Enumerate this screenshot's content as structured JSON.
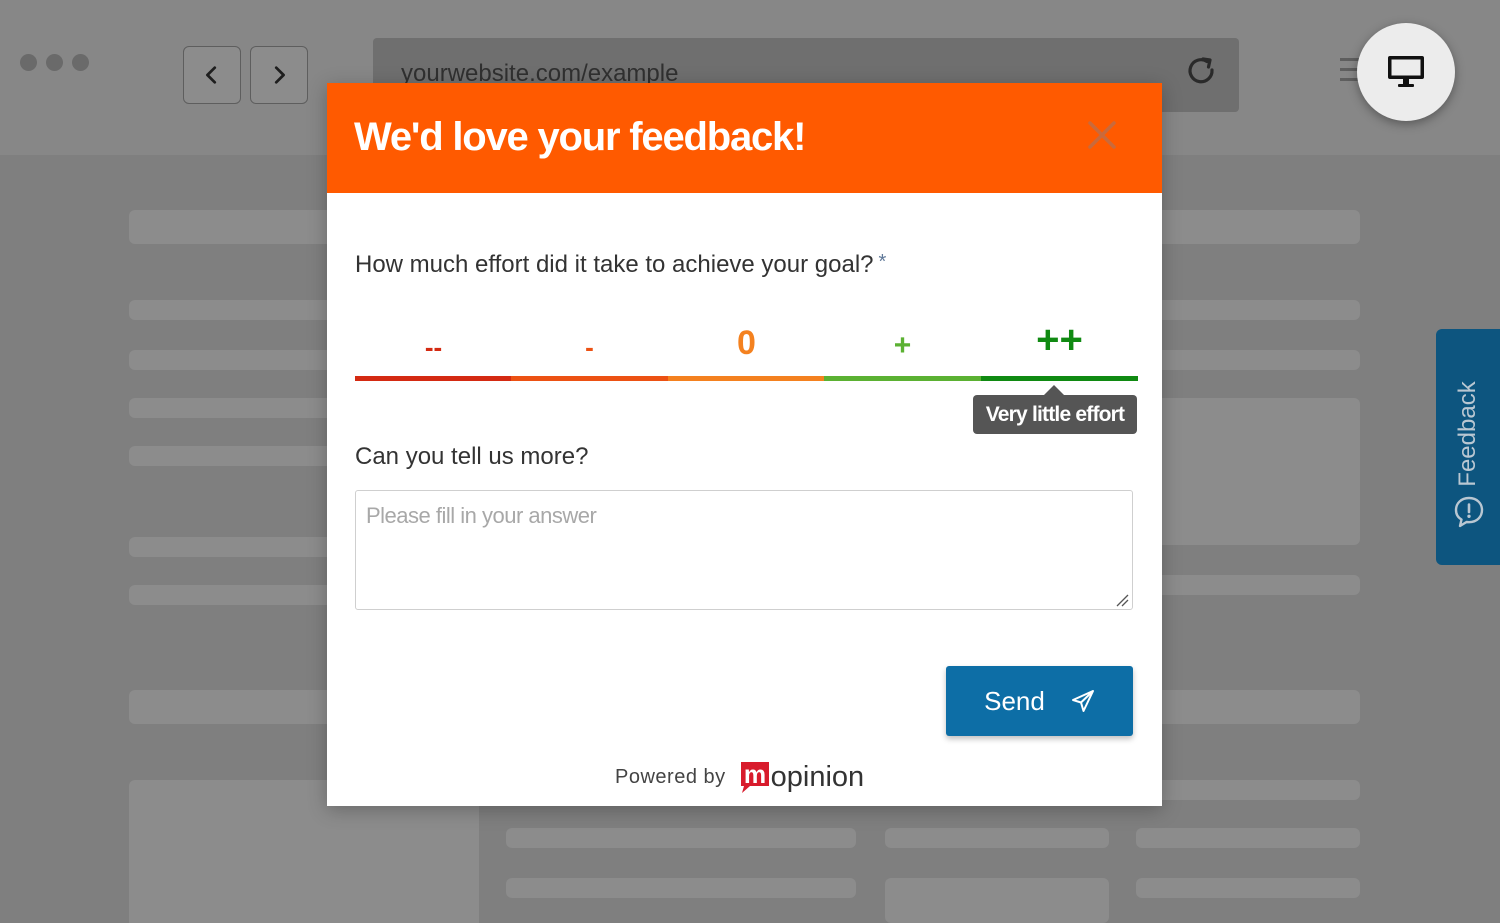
{
  "browser": {
    "address": "yourwebsite.com/example",
    "icons": [
      "window-dots-icon",
      "chevron-left-icon",
      "chevron-right-icon",
      "reload-icon",
      "menu-icon",
      "desktop-monitor-icon"
    ]
  },
  "side_tab": {
    "label": "Feedback",
    "icon": "speech-bubble-exclamation-icon",
    "color": "#0d557f"
  },
  "modal": {
    "title": "We'd love your feedback!",
    "header_color": "#ff5a00",
    "close_icon": "close-icon",
    "question": "How much effort did it take to achieve your goal?",
    "required_mark": "*",
    "scale": [
      {
        "symbol": "--",
        "color": "#d42a12"
      },
      {
        "symbol": "-",
        "color": "#ec5113"
      },
      {
        "symbol": "0",
        "color": "#f4811f"
      },
      {
        "symbol": "+",
        "color": "#5bb132"
      },
      {
        "symbol": "++",
        "color": "#108a12"
      }
    ],
    "selected_tooltip": "Very little effort",
    "question2": "Can you tell us more?",
    "answer": {
      "value": "",
      "placeholder": "Please fill in your answer"
    },
    "send_label": "Send",
    "send_color": "#0d6ea6",
    "send_icon": "paper-plane-icon",
    "powered_by": "Powered by",
    "brand_letter": "m",
    "brand_rest": "opinion",
    "brand_color": "#d81b2c"
  }
}
